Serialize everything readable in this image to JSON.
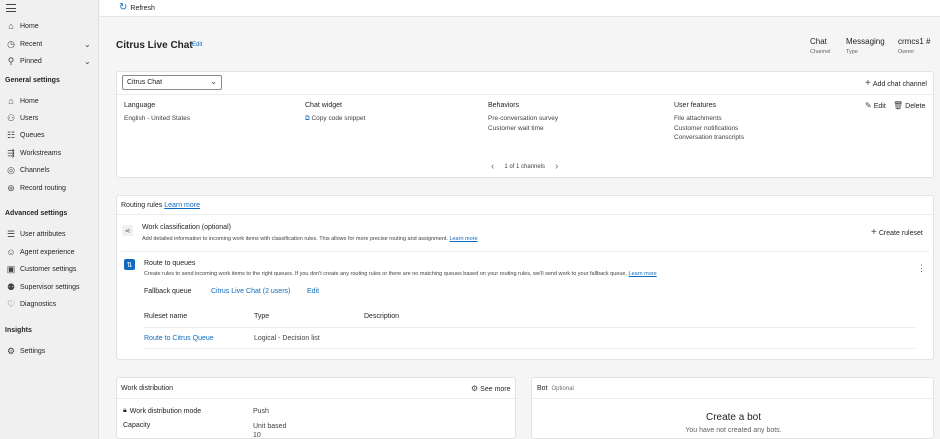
{
  "sidebar": {
    "top_items": [
      {
        "label": "Home",
        "icon": "home-icon"
      },
      {
        "label": "Recent",
        "icon": "clock-icon"
      },
      {
        "label": "Pinned",
        "icon": "pin-icon"
      }
    ],
    "general_title": "General settings",
    "general_items": [
      {
        "label": "Home",
        "icon": "home-icon"
      },
      {
        "label": "Users",
        "icon": "users-icon"
      },
      {
        "label": "Queues",
        "icon": "queues-icon"
      },
      {
        "label": "Workstreams",
        "icon": "workstreams-icon"
      },
      {
        "label": "Channels",
        "icon": "channels-icon"
      },
      {
        "label": "Record routing",
        "icon": "record-routing-icon"
      }
    ],
    "advanced_title": "Advanced settings",
    "advanced_items": [
      {
        "label": "User attributes",
        "icon": "user-attributes-icon"
      },
      {
        "label": "Agent experience",
        "icon": "agent-experience-icon"
      },
      {
        "label": "Customer settings",
        "icon": "customer-settings-icon"
      },
      {
        "label": "Supervisor settings",
        "icon": "supervisor-settings-icon"
      },
      {
        "label": "Diagnostics",
        "icon": "diagnostics-icon"
      }
    ],
    "insights_title": "Insights",
    "insights_items": [
      {
        "label": "Settings",
        "icon": "gear-icon"
      }
    ]
  },
  "toolbar": {
    "refresh_label": "Refresh"
  },
  "header": {
    "title": "Citrus Live Chat",
    "edit_label": "Edit",
    "fields": [
      {
        "value": "Chat",
        "key": "Channel"
      },
      {
        "value": "Messaging",
        "key": "Type"
      },
      {
        "value": "crmcs1 #",
        "key": "Owner"
      }
    ]
  },
  "channel_card": {
    "selected_channel": "Citrus Chat",
    "add_channel_label": "Add chat channel",
    "language_heading": "Language",
    "language_value": "English - United States",
    "widget_heading": "Chat widget",
    "widget_action": "Copy code snippet",
    "behaviors_heading": "Behaviors",
    "behaviors": [
      "Pre-conversation survey",
      "Customer wait time"
    ],
    "features_heading": "User features",
    "features": [
      "File attachments",
      "Customer notifications",
      "Conversation transcripts"
    ],
    "edit_label": "Edit",
    "delete_label": "Delete",
    "pager_text": "1 of 1 channels"
  },
  "routing": {
    "title": "Routing rules",
    "learn_more": "Learn more",
    "classification_title": "Work classification (optional)",
    "classification_desc": "Add detailed information to incoming work items with classification rules. This allows for more precise routing and assignment.",
    "classification_learn_more": "Learn more",
    "create_ruleset_label": "Create ruleset",
    "queues_title": "Route to queues",
    "queues_desc": "Create rules to send incoming work items to the right queues. If you don't create any routing rules or there are no matching queues based on your routing rules, we'll send work to your fallback queue.",
    "queues_learn_more": "Learn more",
    "fallback_label": "Fallback queue",
    "fallback_value": "Citrus Live Chat (2 users)",
    "fallback_edit": "Edit",
    "columns": [
      "Ruleset name",
      "Type",
      "Description"
    ],
    "rows": [
      {
        "name": "Route to Citrus Queue",
        "type": "Logical - Decision list",
        "description": ""
      }
    ]
  },
  "work_distribution": {
    "title": "Work distribution",
    "see_more": "See more",
    "mode_label": "Work distribution mode",
    "mode_value": "Push",
    "capacity_label": "Capacity",
    "capacity_value_1": "Unit based",
    "capacity_value_2": "10"
  },
  "bot": {
    "title": "Bot",
    "optional": "Optional",
    "create_title": "Create a bot",
    "create_sub": "You have not created any bots."
  },
  "colors": {
    "accent": "#0f6cbd",
    "background": "#f5f5f5",
    "card": "#ffffff"
  }
}
